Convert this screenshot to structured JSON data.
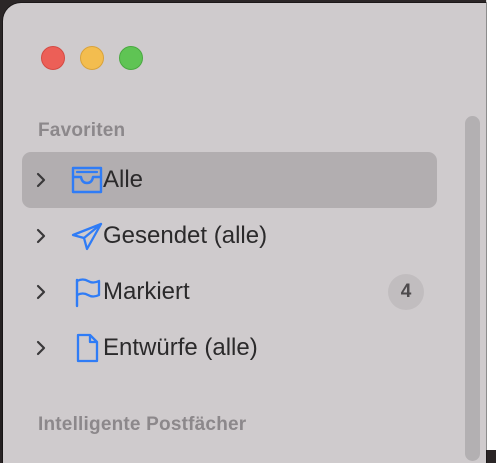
{
  "sidebar": {
    "sections": [
      {
        "title": "Favoriten",
        "items": [
          {
            "label": "Alle",
            "icon": "tray-icon",
            "selected": true
          },
          {
            "label": "Gesendet (alle)",
            "icon": "paper-plane-icon"
          },
          {
            "label": "Markiert",
            "icon": "flag-icon",
            "badge": "4"
          },
          {
            "label": "Entwürfe (alle)",
            "icon": "document-icon"
          }
        ]
      },
      {
        "title": "Intelligente Postfächer"
      }
    ]
  },
  "colors": {
    "accent": "#2f7cf6",
    "sidebar_bg": "#cfcbcd",
    "selection_bg": "#b2aeb0",
    "close": "#ec5f57",
    "minimize": "#f3bd4f",
    "zoom": "#5fc454"
  }
}
